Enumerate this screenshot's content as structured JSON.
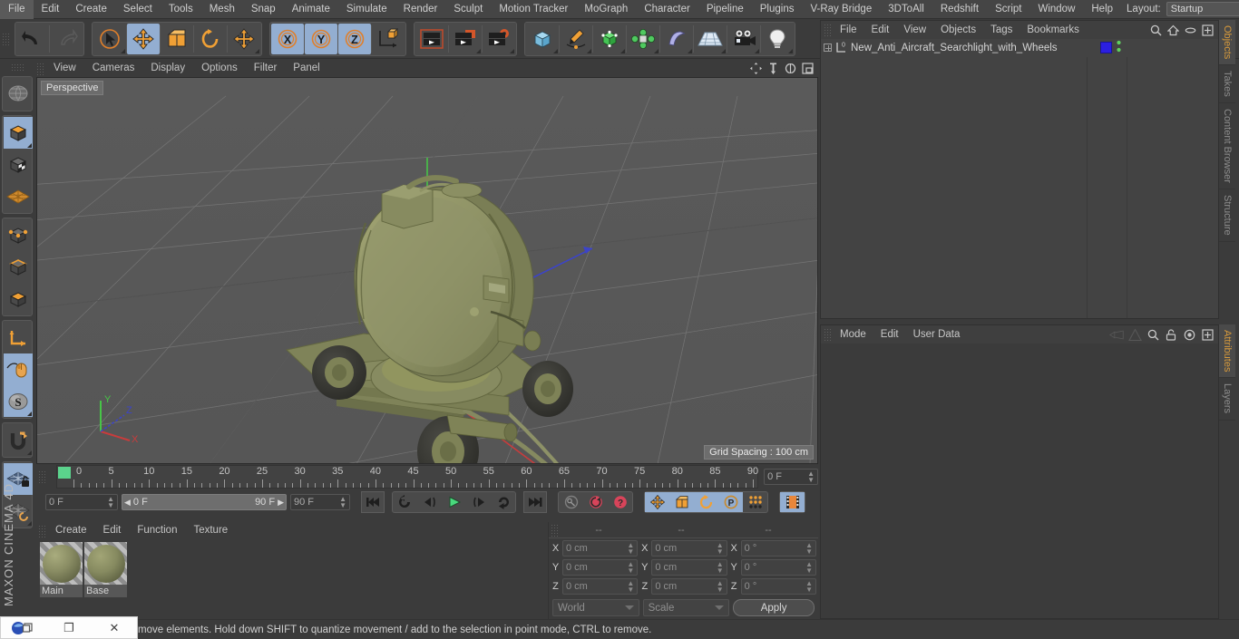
{
  "app": {
    "brand_top": "MAXON",
    "brand_bottom": "CINEMA 4D"
  },
  "menubar": {
    "items": [
      "File",
      "Edit",
      "Create",
      "Select",
      "Tools",
      "Mesh",
      "Snap",
      "Animate",
      "Simulate",
      "Render",
      "Sculpt",
      "Motion Tracker",
      "MoGraph",
      "Character",
      "Pipeline",
      "Plugins",
      "V-Ray Bridge",
      "3DToAll",
      "Redshift",
      "Script",
      "Window",
      "Help"
    ],
    "layout_label": "Layout:",
    "layout_value": "Startup",
    "search_icon": "search-icon"
  },
  "toolbar": {
    "groups": [
      {
        "name": "undo-redo",
        "buttons": [
          {
            "name": "undo-button",
            "icon": "undo-arrow-icon",
            "active": false
          },
          {
            "name": "redo-button",
            "icon": "redo-arrow-icon",
            "active": false
          }
        ]
      },
      {
        "name": "transform-tools",
        "buttons": [
          {
            "name": "live-selection-tool",
            "icon": "cursor-circle-icon",
            "active": false
          },
          {
            "name": "move-tool",
            "icon": "move-cross-icon",
            "active": true
          },
          {
            "name": "scale-tool",
            "icon": "scale-box-icon",
            "active": false
          },
          {
            "name": "rotate-tool",
            "icon": "rotate-circle-icon",
            "active": false
          },
          {
            "name": "move-duplicate-tool",
            "icon": "move-cross-icon",
            "active": false
          }
        ]
      },
      {
        "name": "axis-locks",
        "buttons": [
          {
            "name": "lock-x-axis",
            "icon": "x-axis-icon",
            "active": true
          },
          {
            "name": "lock-y-axis",
            "icon": "y-axis-icon",
            "active": true
          },
          {
            "name": "lock-z-axis",
            "icon": "z-axis-icon",
            "active": true
          },
          {
            "name": "world-object-axis",
            "icon": "world-axis-cube-icon",
            "active": false
          }
        ]
      },
      {
        "name": "render-tools",
        "buttons": [
          {
            "name": "render-view-button",
            "icon": "render-clapper-icon",
            "active": false
          },
          {
            "name": "render-to-picture-viewer-button",
            "icon": "render-picture-icon",
            "active": false
          },
          {
            "name": "render-settings-button",
            "icon": "render-gear-icon",
            "active": false
          }
        ]
      },
      {
        "name": "object-creation",
        "buttons": [
          {
            "name": "add-cube-button",
            "icon": "cube-icon",
            "active": false
          },
          {
            "name": "add-spline-button",
            "icon": "pen-spline-icon",
            "active": false
          },
          {
            "name": "add-generator-button",
            "icon": "green-cube-icon",
            "active": false
          },
          {
            "name": "add-array-button",
            "icon": "green-cluster-icon",
            "active": false
          },
          {
            "name": "add-deformer-button",
            "icon": "bend-deformer-icon",
            "active": false
          },
          {
            "name": "add-scene-object-button",
            "icon": "floor-grid-icon",
            "active": false
          },
          {
            "name": "add-camera-button",
            "icon": "camera-icon",
            "active": false
          },
          {
            "name": "add-light-button",
            "icon": "lightbulb-icon",
            "active": false
          }
        ]
      }
    ]
  },
  "left_toolbar": {
    "groups": [
      {
        "name": "globe-group",
        "buttons": [
          {
            "name": "undo-view-button",
            "icon": "globe-wire-icon",
            "active": false
          }
        ]
      },
      {
        "name": "mode-group",
        "buttons": [
          {
            "name": "make-editable-button",
            "icon": "editable-cube-icon",
            "active": true
          },
          {
            "name": "model-mode-button",
            "icon": "texture-cube-icon",
            "active": false
          },
          {
            "name": "texture-mode-button",
            "icon": "orange-grid-icon",
            "active": false
          }
        ]
      },
      {
        "name": "component-group",
        "buttons": [
          {
            "name": "points-mode-button",
            "icon": "point-cube-icon",
            "active": false
          },
          {
            "name": "edges-mode-button",
            "icon": "edge-cube-icon",
            "active": false
          },
          {
            "name": "polygons-mode-button",
            "icon": "polygon-cube-icon",
            "active": false
          }
        ]
      },
      {
        "name": "axis-group",
        "buttons": [
          {
            "name": "enable-axis-button",
            "icon": "axis-angle-icon",
            "active": false
          },
          {
            "name": "enable-snapping-button",
            "icon": "mouse-icon",
            "active": true
          },
          {
            "name": "soft-selection-button",
            "icon": "s-sphere-icon",
            "active": true
          }
        ]
      },
      {
        "name": "magnet-group",
        "buttons": [
          {
            "name": "magnet-tool-button",
            "icon": "magnet-icon",
            "active": false
          }
        ]
      },
      {
        "name": "workplane-group",
        "buttons": [
          {
            "name": "lock-workplane-button",
            "icon": "grid-lock-icon",
            "active": true
          },
          {
            "name": "planar-workplane-button",
            "icon": "grid-rotate-icon",
            "active": false
          }
        ]
      }
    ]
  },
  "viewport": {
    "menu": [
      "View",
      "Cameras",
      "Display",
      "Options",
      "Filter",
      "Panel"
    ],
    "label": "Perspective",
    "grid_spacing": "Grid Spacing : 100 cm",
    "icons": [
      "move-view-icon",
      "scale-view-icon",
      "rotate-view-icon",
      "maximize-view-icon"
    ],
    "axis_gizmo": {
      "x": "X",
      "y": "Y",
      "z": "Z",
      "x_color": "#d84a4a",
      "y_color": "#4ad84a",
      "z_color": "#4a6ad8"
    },
    "model_name": "anti-aircraft searchlight with wheels"
  },
  "timeline": {
    "ruler_ticks": [
      0,
      5,
      10,
      15,
      20,
      25,
      30,
      35,
      40,
      45,
      50,
      55,
      60,
      65,
      70,
      75,
      80,
      85,
      90
    ],
    "current_frame_field": "0 F",
    "start_frame_field": "0 F",
    "range_start": "0 F",
    "range_end": "90 F",
    "end_frame_field": "90 F",
    "transport": [
      {
        "name": "go-to-start-button",
        "icon": "skip-start-icon",
        "active": false
      },
      {
        "name": "play-backwards-button",
        "icon": "rewind-circle-icon",
        "active": false
      },
      {
        "name": "previous-frame-button",
        "icon": "step-back-icon",
        "active": false
      },
      {
        "name": "play-forward-button",
        "icon": "play-icon",
        "active": false
      },
      {
        "name": "next-frame-button",
        "icon": "step-forward-icon",
        "active": false
      },
      {
        "name": "loop-button",
        "icon": "loop-arrow-icon",
        "active": false
      },
      {
        "name": "go-to-end-button",
        "icon": "skip-end-icon",
        "active": false
      }
    ],
    "record_group": [
      {
        "name": "record-active-objects-button",
        "icon": "key-icon",
        "active": false
      },
      {
        "name": "autokeying-button",
        "icon": "red-circle-arrow-icon",
        "active": false
      },
      {
        "name": "keyframe-selection-button",
        "icon": "red-question-icon",
        "active": false
      }
    ],
    "key_group": [
      {
        "name": "record-position-button",
        "icon": "move-cross-icon",
        "active": true
      },
      {
        "name": "record-scale-button",
        "icon": "scale-box-icon",
        "active": true
      },
      {
        "name": "record-rotation-button",
        "icon": "rotate-circle-icon",
        "active": true
      },
      {
        "name": "record-parameter-button",
        "icon": "p-circle-icon",
        "active": true
      },
      {
        "name": "record-pla-button",
        "icon": "point-level-icon",
        "active": false
      }
    ],
    "extra_group": [
      {
        "name": "timeline-toggle-button",
        "icon": "filmstrip-icon",
        "active": true
      }
    ]
  },
  "material_manager": {
    "menu": [
      "Create",
      "Edit",
      "Function",
      "Texture"
    ],
    "materials": [
      {
        "name": "Main",
        "color": "#8a8d64",
        "selected": true
      },
      {
        "name": "Base",
        "color": "#868a60",
        "selected": false
      }
    ]
  },
  "coordinates": {
    "headers": [
      "--",
      "--",
      "--"
    ],
    "rows": [
      {
        "axis": "X",
        "position": "0 cm",
        "size": "0 cm",
        "rotation": "0 °"
      },
      {
        "axis": "Y",
        "position": "0 cm",
        "size": "0 cm",
        "rotation": "0 °"
      },
      {
        "axis": "Z",
        "position": "0 cm",
        "size": "0 cm",
        "rotation": "0 °"
      }
    ],
    "system": "World",
    "mode": "Scale",
    "apply_label": "Apply"
  },
  "object_manager": {
    "menu": [
      "File",
      "Edit",
      "View",
      "Objects",
      "Tags",
      "Bookmarks"
    ],
    "icons": [
      "search-icon",
      "home-icon",
      "ellipse-icon",
      "frame-icon"
    ],
    "objects": [
      {
        "name": "New_Anti_Aircraft_Searchlight_with_Wheels",
        "icon": "null-object-icon",
        "tag_color": "#2b1fe0",
        "dots_color": "#5fd15f"
      }
    ]
  },
  "attribute_manager": {
    "menu": [
      "Mode",
      "Edit",
      "User Data"
    ],
    "icons": [
      "back-arrow-icon",
      "forward-arrow-icon",
      "search-icon",
      "lock-icon",
      "target-icon",
      "frame-icon"
    ]
  },
  "right_tabs_top": [
    {
      "label": "Objects",
      "active": true
    },
    {
      "label": "Takes",
      "active": false
    },
    {
      "label": "Content Browser",
      "active": false
    },
    {
      "label": "Structure",
      "active": false
    }
  ],
  "right_tabs_bottom": [
    {
      "label": "Attributes",
      "active": true
    },
    {
      "label": "Layers",
      "active": false
    }
  ],
  "statusbar": {
    "text": "move elements. Hold down SHIFT to quantize movement / add to the selection in point mode, CTRL to remove."
  },
  "overlay_window": {
    "app_icon": "blue-orb-icon",
    "restore_icon": "❐",
    "close_icon": "✕"
  },
  "colors": {
    "accent_orange": "#d79a3c",
    "active_blue": "#93aed1",
    "panel_bg": "#3b3b3b",
    "viewport_bg": "#5d5d5d",
    "model_green": "#8a8d64"
  }
}
